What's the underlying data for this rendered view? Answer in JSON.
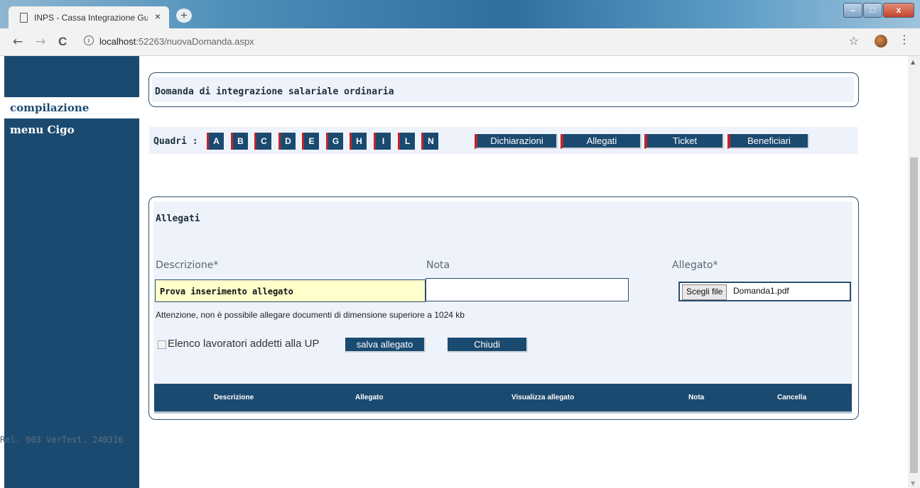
{
  "browser": {
    "tab_title": "INPS - Cassa Integrazione Guadagni",
    "tab_close": "×",
    "new_tab": "+",
    "url_host": "localhost",
    "url_rest": ":52263/nuovaDomanda.aspx",
    "info": "i",
    "back": "←",
    "forward": "→",
    "reload": "C",
    "star": "☆",
    "menu": "⋮",
    "win_min": "–",
    "win_max": "□",
    "win_close": "x"
  },
  "sidebar": {
    "active_item": "compilazione",
    "menu_item": "menu Cigo",
    "release": "Rel. 003 VerTest. 240316"
  },
  "header": {
    "title": "Domanda di integrazione salariale ordinaria"
  },
  "quadri": {
    "label": "Quadri :",
    "letters": [
      "A",
      "B",
      "C",
      "D",
      "E",
      "G",
      "H",
      "I",
      "L",
      "N"
    ],
    "sections": [
      "Dichiarazioni",
      "Allegati",
      "Ticket",
      "Beneficiari"
    ]
  },
  "allegati": {
    "title": "Allegati",
    "descrizione_label": "Descrizione*",
    "nota_label": "Nota",
    "allegato_label": "Allegato*",
    "descrizione_value": "Prova inserimento allegato",
    "nota_value": "",
    "choose_file_label": "Scegli file",
    "file_name": "Domanda1.pdf",
    "warning": "Attenzione, non è possibile allegare documenti di dimensione superiore a 1024 kb",
    "checkbox_label": "Elenco lavoratori addetti alla UP",
    "checkbox_checked": false,
    "save_button": "salva allegato",
    "close_button": "Chiudi",
    "table_headers": [
      "Descrizione",
      "Allegato",
      "Visualizza allegato",
      "Nota",
      "Cancella"
    ]
  },
  "colors": {
    "primary": "#1b4a70",
    "accent": "#c0252b",
    "input_highlight": "#ffffcc"
  }
}
